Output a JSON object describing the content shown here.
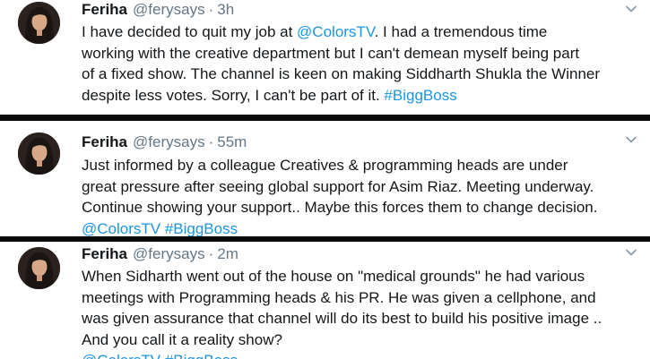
{
  "tweets": [
    {
      "name": "Feriha",
      "handle": "@ferysays",
      "separator": "·",
      "time": "3h",
      "lines": [
        {
          "before": "I have decided to quit my job at ",
          "link": "@ColorsTV",
          "after": ". I had a tremendous time"
        },
        {
          "before": "working with the creative department but I can't demean myself being part",
          "link": "",
          "after": ""
        },
        {
          "before": "of a fixed show. The channel is keen on making Siddharth Shukla the Winner",
          "link": "",
          "after": ""
        },
        {
          "before": "despite less votes. Sorry, I can't be part of it.  ",
          "link": "#BiggBoss",
          "after": ""
        }
      ]
    },
    {
      "name": "Feriha",
      "handle": "@ferysays",
      "separator": "·",
      "time": "55m",
      "lines": [
        {
          "before": "Just informed by a colleague Creatives & programming heads are under",
          "link": "",
          "after": ""
        },
        {
          "before": "great pressure after seeing global support for Asim Riaz. Meeting underway.",
          "link": "",
          "after": ""
        },
        {
          "before": "Continue showing your support.. Maybe this forces them to change decision.",
          "link": "",
          "after": ""
        },
        {
          "before": "",
          "link": "@ColorsTV #BiggBoss",
          "after": ""
        }
      ]
    },
    {
      "name": "Feriha",
      "handle": "@ferysays",
      "separator": "·",
      "time": "2m",
      "lines": [
        {
          "before": "When Sidharth went out of the house on \"medical grounds\" he had various",
          "link": "",
          "after": ""
        },
        {
          "before": "meetings with Programming heads & his PR. He was given a cellphone, and",
          "link": "",
          "after": ""
        },
        {
          "before": "was given assurance that channel will do its best to build his positive image ..",
          "link": "",
          "after": ""
        },
        {
          "before": "And you call it a reality show?",
          "link": "",
          "after": ""
        },
        {
          "before": "",
          "link": "@ColorsTV #BiggBoss",
          "after": ""
        }
      ]
    }
  ],
  "colors": {
    "link": "#1b95e0",
    "meta": "#657786",
    "text": "#14171a",
    "divider": "#0b0b0b"
  },
  "icons": {
    "avatar": "profile-photo",
    "caret": "chevron-down-icon"
  }
}
